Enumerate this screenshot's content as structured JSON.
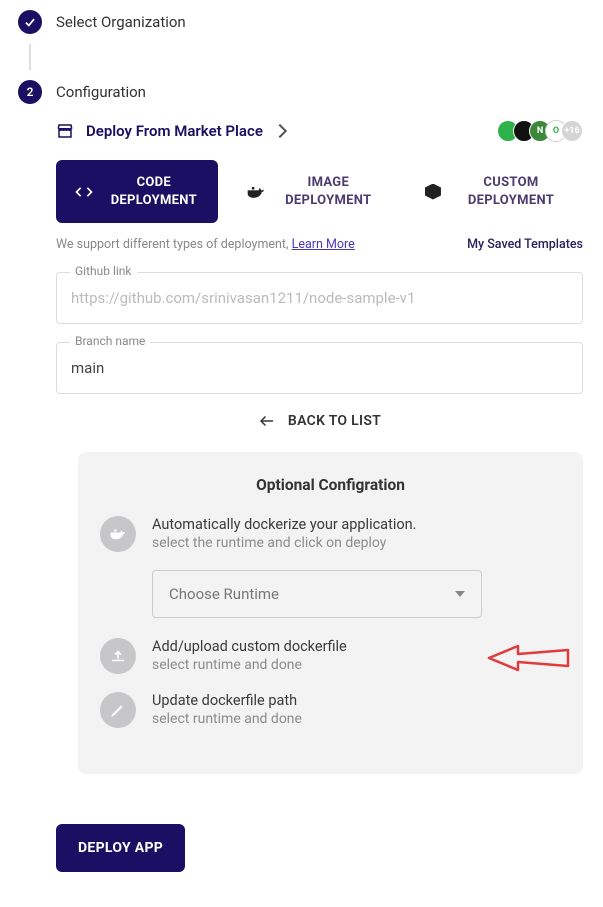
{
  "steps": {
    "s1": {
      "label": "Select Organization"
    },
    "s2": {
      "num": "2",
      "label": "Configuration"
    }
  },
  "deploy_from": {
    "label": "Deploy From Market Place"
  },
  "tabs": {
    "code": "CODE DEPLOYMENT",
    "image": "IMAGE DEPLOYMENT",
    "custom": "CUSTOM DEPLOYMENT"
  },
  "support": {
    "text": "We support different types of deployment, ",
    "link": "Learn More",
    "saved": "My Saved Templates"
  },
  "fields": {
    "github_label": "Github link",
    "github_placeholder": "https://github.com/srinivasan1211/node-sample-v1",
    "branch_label": "Branch name",
    "branch_value": "main"
  },
  "back_label": "BACK TO LIST",
  "panel": {
    "title": "Optional Configration",
    "opt1": {
      "t1": "Automatically dockerize your application.",
      "t2": "select the runtime and click on deploy"
    },
    "runtime_placeholder": "Choose Runtime",
    "opt2": {
      "t1": "Add/upload custom dockerfile",
      "t2": "select runtime and done"
    },
    "opt3": {
      "t1": "Update dockerfile path",
      "t2": "select runtime and done"
    }
  },
  "deploy_btn": "DEPLOY APP",
  "badge_text": {
    "n": "N",
    "o": "O",
    "plus": "+16"
  }
}
